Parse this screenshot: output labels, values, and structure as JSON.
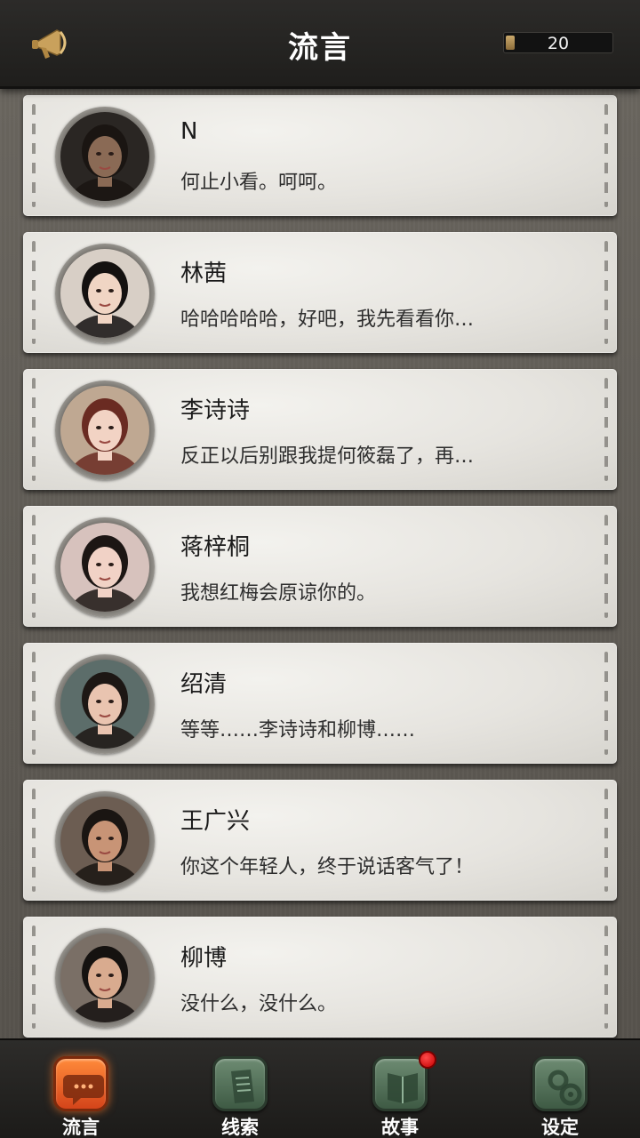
{
  "header": {
    "title": "流言",
    "counter_value": "20",
    "counter_fill_fraction": 0.08,
    "left_icon": "megaphone-icon"
  },
  "messages": [
    {
      "name": "N",
      "text": "何止小看。呵呵。",
      "avatar": "avatar-n",
      "colors": {
        "bg": "#2a2623",
        "skin": "#8a6a55",
        "hair": "#1a1512"
      }
    },
    {
      "name": "林茜",
      "text": "哈哈哈哈哈，好吧，我先看看你…",
      "avatar": "avatar-linqian",
      "colors": {
        "bg": "#d8cfc6",
        "skin": "#f0d5c4",
        "hair": "#141110"
      }
    },
    {
      "name": "李诗诗",
      "text": "反正以后别跟我提何筱磊了，再…",
      "avatar": "avatar-lishishi",
      "colors": {
        "bg": "#bfa892",
        "skin": "#f2d3c4",
        "hair": "#6a2b22"
      }
    },
    {
      "name": "蒋梓桐",
      "text": "我想红梅会原谅你的。",
      "avatar": "avatar-jiangzitong",
      "colors": {
        "bg": "#d7c2bd",
        "skin": "#f1d2c6",
        "hair": "#1c1614"
      }
    },
    {
      "name": "绍清",
      "text": "等等……李诗诗和柳博……",
      "avatar": "avatar-shaoqing",
      "colors": {
        "bg": "#5c6d6a",
        "skin": "#e9c4b0",
        "hair": "#1d1714"
      }
    },
    {
      "name": "王广兴",
      "text": "你这个年轻人，终于说话客气了！",
      "avatar": "avatar-wangguangxing",
      "colors": {
        "bg": "#6c5d52",
        "skin": "#c89476",
        "hair": "#1a1512"
      }
    },
    {
      "name": "柳博",
      "text": "没什么，没什么。",
      "avatar": "avatar-liubo",
      "colors": {
        "bg": "#7a6f66",
        "skin": "#d9ab8f",
        "hair": "#151210"
      }
    }
  ],
  "nav": [
    {
      "label": "流言",
      "icon": "chat-bubble-icon",
      "active": true,
      "badge": false
    },
    {
      "label": "线索",
      "icon": "document-icon",
      "active": false,
      "badge": false
    },
    {
      "label": "故事",
      "icon": "book-icon",
      "active": false,
      "badge": true
    },
    {
      "label": "设定",
      "icon": "gear-icon",
      "active": false,
      "badge": false
    }
  ],
  "colors": {
    "accent": "#e8581f",
    "nav_icon": "#4f6e55",
    "badge": "#e00000",
    "header_bg": "#262523"
  }
}
